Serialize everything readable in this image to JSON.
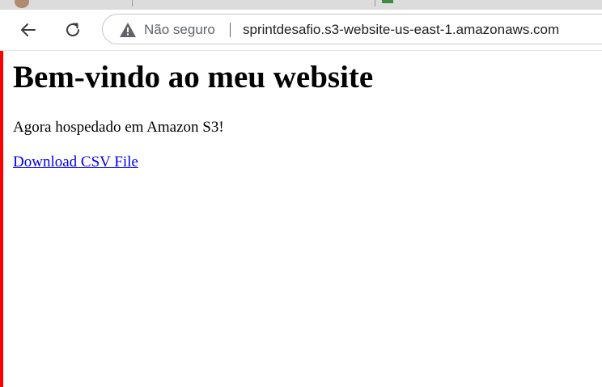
{
  "browser": {
    "security_label": "Não seguro",
    "url": "sprintdesafio.s3-website-us-east-1.amazonaws.com",
    "icons": {
      "back": "arrow-left-icon",
      "reload": "reload-icon",
      "security": "warning-triangle-icon"
    }
  },
  "page": {
    "heading": "Bem-vindo ao meu website",
    "paragraph": "Agora hospedado em Amazon S3!",
    "link_text": "Download CSV File",
    "link_color": "#0000ee",
    "edge_color": "#ff0000"
  }
}
